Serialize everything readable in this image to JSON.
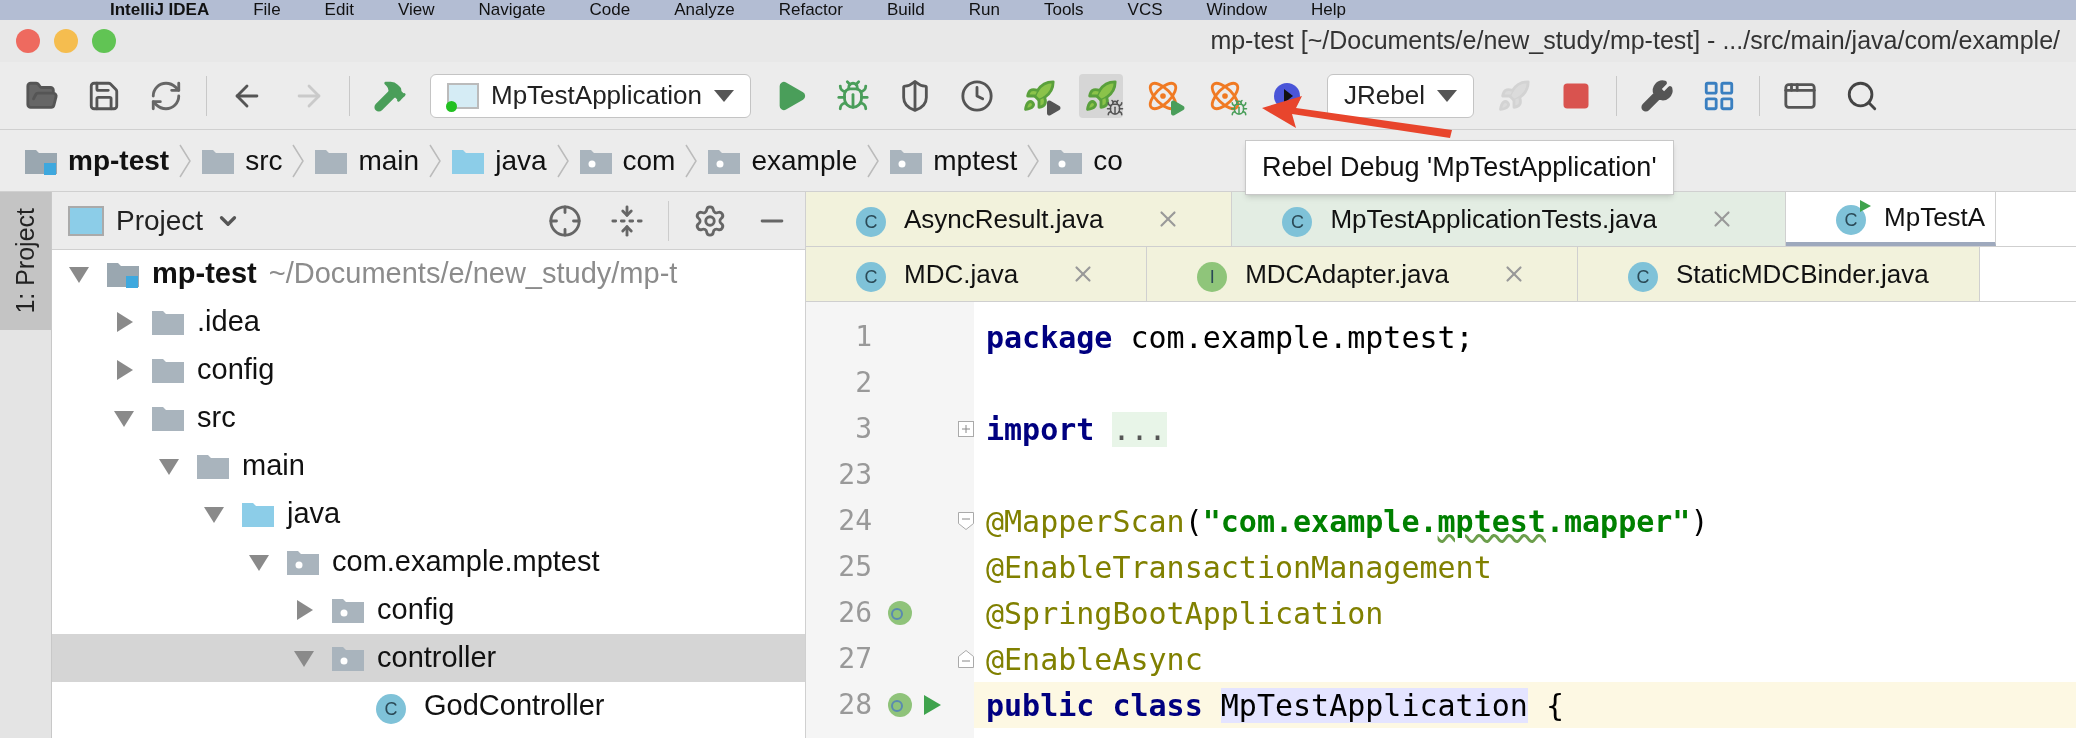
{
  "menu_bar": [
    "IntelliJ IDEA",
    "File",
    "Edit",
    "View",
    "Navigate",
    "Code",
    "Analyze",
    "Refactor",
    "Build",
    "Run",
    "Tools",
    "VCS",
    "Window",
    "Help"
  ],
  "window": {
    "title": "mp-test [~/Documents/e/new_study/mp-test] - .../src/main/java/com/example/"
  },
  "toolbar": [
    {
      "kind": "open",
      "hovered": false,
      "disabled": false
    },
    {
      "kind": "save",
      "hovered": false,
      "disabled": false
    },
    {
      "kind": "sync",
      "hovered": false,
      "disabled": false
    },
    {
      "kind": "separator"
    },
    {
      "kind": "back",
      "hovered": false,
      "disabled": false
    },
    {
      "kind": "forward",
      "hovered": false,
      "disabled": true
    },
    {
      "kind": "separator"
    },
    {
      "kind": "build",
      "hovered": false,
      "disabled": false
    },
    {
      "kind": "run_config",
      "label": "MpTestApplication"
    },
    {
      "kind": "run",
      "hovered": false,
      "disabled": false
    },
    {
      "kind": "debug",
      "hovered": false,
      "disabled": false
    },
    {
      "kind": "coverage",
      "hovered": false,
      "disabled": false
    },
    {
      "kind": "profile",
      "hovered": false,
      "disabled": false
    },
    {
      "kind": "rebel_run",
      "hovered": false,
      "disabled": false
    },
    {
      "kind": "rebel_debug",
      "hovered": true,
      "disabled": false
    },
    {
      "kind": "remote_run",
      "hovered": false,
      "disabled": false
    },
    {
      "kind": "remote_debug",
      "hovered": false,
      "disabled": false
    },
    {
      "kind": "attach",
      "hovered": false,
      "disabled": false
    },
    {
      "kind": "jrebel_config",
      "label": "JRebel"
    },
    {
      "kind": "deploy",
      "hovered": false,
      "disabled": true
    },
    {
      "kind": "stop",
      "hovered": false,
      "disabled": false
    },
    {
      "kind": "separator"
    },
    {
      "kind": "settings",
      "hovered": false,
      "disabled": false
    },
    {
      "kind": "structure",
      "hovered": false,
      "disabled": false
    },
    {
      "kind": "separator"
    },
    {
      "kind": "run_window",
      "hovered": false,
      "disabled": false
    },
    {
      "kind": "search",
      "hovered": false,
      "disabled": false
    }
  ],
  "tooltip": "Rebel Debug 'MpTestApplication'",
  "breadcrumbs": [
    {
      "label": "mp-test",
      "kind": "module"
    },
    {
      "label": "src",
      "kind": "folder"
    },
    {
      "label": "main",
      "kind": "folder"
    },
    {
      "label": "java",
      "kind": "source"
    },
    {
      "label": "com",
      "kind": "package"
    },
    {
      "label": "example",
      "kind": "package"
    },
    {
      "label": "mptest",
      "kind": "package"
    },
    {
      "label": "co",
      "kind": "package"
    }
  ],
  "side_strip": {
    "label": "1: Project",
    "selected": true
  },
  "project_panel": {
    "title": "Project",
    "tree": [
      {
        "label": "mp-test",
        "kind": "module",
        "hint": "~/Documents/e/new_study/mp-t",
        "expanded": true,
        "selected": false,
        "children": [
          {
            "label": ".idea",
            "kind": "folder",
            "expanded": false,
            "selected": false
          },
          {
            "label": "config",
            "kind": "folder",
            "expanded": false,
            "selected": false
          },
          {
            "label": "src",
            "kind": "folder",
            "expanded": true,
            "selected": false,
            "children": [
              {
                "label": "main",
                "kind": "folder",
                "expanded": true,
                "selected": false,
                "children": [
                  {
                    "label": "java",
                    "kind": "source",
                    "expanded": true,
                    "selected": false,
                    "children": [
                      {
                        "label": "com.example.mptest",
                        "kind": "package",
                        "expanded": true,
                        "selected": false,
                        "children": [
                          {
                            "label": "config",
                            "kind": "package",
                            "expanded": false,
                            "selected": false
                          },
                          {
                            "label": "controller",
                            "kind": "package",
                            "expanded": true,
                            "selected": true,
                            "children": [
                              {
                                "label": "GodController",
                                "kind": "class",
                                "badge": "C",
                                "selected": false
                              }
                            ]
                          }
                        ]
                      }
                    ]
                  }
                ]
              }
            ]
          }
        ]
      }
    ]
  },
  "editor_tabs": [
    [
      {
        "label": "AsyncResult.java",
        "badge": "C",
        "kind": "class",
        "color": "#f2f2dc",
        "selected": false,
        "closable": true
      },
      {
        "label": "MpTestApplicationTests.java",
        "badge": "C",
        "kind": "class",
        "color": "#e3ede3",
        "selected": false,
        "closable": true
      },
      {
        "label": "MpTestA",
        "badge": "C",
        "kind": "runnable",
        "color": "#ffffff",
        "selected": true,
        "closable": false
      }
    ],
    [
      {
        "label": "MDC.java",
        "badge": "C",
        "kind": "class",
        "color": "#f2f2dc",
        "selected": false,
        "closable": true
      },
      {
        "label": "MDCAdapter.java",
        "badge": "I",
        "kind": "interface",
        "color": "#f2f2dc",
        "selected": false,
        "closable": true
      },
      {
        "label": "StaticMDCBinder.java",
        "badge": "C",
        "kind": "class",
        "color": "#f2f2dc",
        "selected": false,
        "closable": false
      }
    ]
  ],
  "code": [
    {
      "number": "1",
      "current": false,
      "tokens": [
        {
          "text": "package",
          "kind": "keyword"
        },
        {
          "text": " com.example.mptest;",
          "kind": "plain"
        }
      ]
    },
    {
      "number": "2",
      "current": false
    },
    {
      "number": "3",
      "current": false,
      "fold_marker": {
        "kind": "collapsed"
      },
      "tokens": [
        {
          "text": "import ",
          "kind": "keyword"
        },
        {
          "text": "...",
          "kind": "folded"
        }
      ]
    },
    {
      "number": "23",
      "current": false
    },
    {
      "number": "24",
      "current": false,
      "fold_marker": {
        "kind": "start"
      },
      "tokens": [
        {
          "text": "@MapperScan",
          "kind": "annotation"
        },
        {
          "text": "(",
          "kind": "plain"
        },
        {
          "text": "\"com.example.",
          "kind": "string"
        },
        {
          "text": "mptest",
          "kind": "typo"
        },
        {
          "text": ".mapper\"",
          "kind": "string"
        },
        {
          "text": ")",
          "kind": "plain"
        }
      ]
    },
    {
      "number": "25",
      "current": false,
      "tokens": [
        {
          "text": "@EnableTransactionManagement",
          "kind": "annotation"
        }
      ]
    },
    {
      "number": "26",
      "current": false,
      "gutter_icons": [
        {
          "kind": "bean"
        }
      ],
      "tokens": [
        {
          "text": "@SpringBootApplication",
          "kind": "annotation"
        }
      ]
    },
    {
      "number": "27",
      "current": false,
      "fold_marker": {
        "kind": "end"
      },
      "tokens": [
        {
          "text": "@EnableAsync",
          "kind": "annotation"
        }
      ]
    },
    {
      "number": "28",
      "current": true,
      "gutter_icons": [
        {
          "kind": "bean"
        },
        {
          "kind": "run"
        }
      ],
      "tokens": [
        {
          "text": "public class ",
          "kind": "keyword"
        },
        {
          "text": "MpTestApplication",
          "kind": "highlighted"
        },
        {
          "text": " {",
          "kind": "plain"
        }
      ]
    }
  ]
}
